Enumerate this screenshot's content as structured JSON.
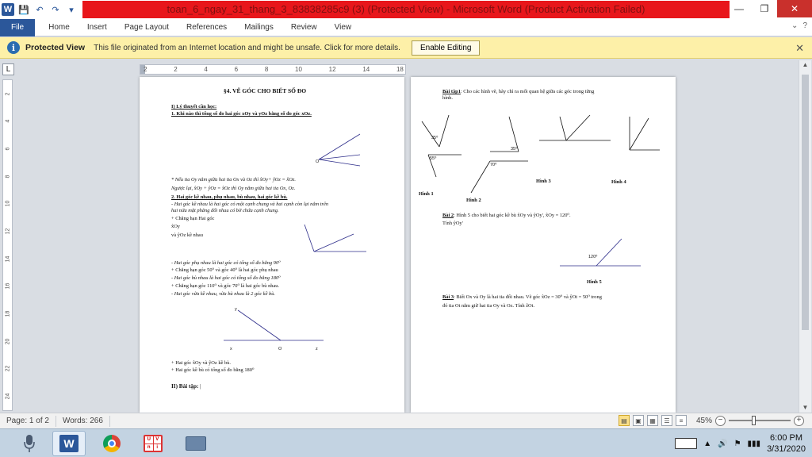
{
  "window": {
    "title": "toan_6_ngay_31_thang_3_83838285c9 (3) (Protected View) - Microsoft Word (Product Activation Failed)",
    "word_logo_letter": "W",
    "save_glyph": "💾",
    "undo_glyph": "↶",
    "redo_glyph": "↷",
    "qat_more_glyph": "▾",
    "minimize_glyph": "—",
    "restore_glyph": "❐",
    "close_glyph": "✕"
  },
  "ribbon": {
    "tabs": [
      "File",
      "Home",
      "Insert",
      "Page Layout",
      "References",
      "Mailings",
      "Review",
      "View"
    ],
    "help_glyph": "?",
    "expand_glyph": "⌄"
  },
  "protected_view": {
    "info_glyph": "i",
    "title": "Protected View",
    "message": "This file originated from an Internet location and might be unsafe. Click for more details.",
    "button": "Enable Editing",
    "close_glyph": "✕"
  },
  "ruler": {
    "corner_glyph": "L",
    "h_ticks": [
      "2",
      "2",
      "4",
      "6",
      "8",
      "10",
      "12",
      "14",
      "18"
    ],
    "v_ticks": [
      "2",
      "4",
      "6",
      "8",
      "10",
      "12",
      "14",
      "16",
      "18",
      "20",
      "22",
      "24"
    ]
  },
  "page1": {
    "title": "§4. VẼ GÓC CHO BIẾT SỐ ĐO",
    "section1": "I) Lý thuyết cần  học:",
    "q1": "1. Khi nào thì tổng số đo hai góc xOy và yOz bằng số đo góc xOz.",
    "note1": "* Nếu tia Oy nằm giữa hai tia Ox và Oz thì x̂Oy+ ŷOz = x̂Oz.",
    "note2": " Ngược lại, x̂Oy + ŷOz = x̂Oz thì Oy nằm giữa hai tia Ox, Oz.",
    "q2": "2.  Hai góc kề nhau, phụ nhau, bù nhau, hai góc kề bù.",
    "def1": "-  Hai góc kề nhau là hai góc có một cạnh chung và hai cạnh còn lại nằm trên",
    "def1b": "hai nửa mặt phẳng đối nhau có bờ chứa cạnh chung.",
    "ex1a": "+    Chẳng   hạn   Hai    góc",
    "ex1b": "x̂Oy",
    "ex1c": " và  ŷOz  kề nhau",
    "def2": "-  Hai góc phụ nhau là hai góc có tổng số đo bằng 90⁰",
    "ex2": "+ Chẳng hạn góc 50⁰  và góc 40⁰ là hai góc phụ nhau",
    "def3": "- Hai góc bù nhau là hai góc có tổng số đo bằng 180⁰",
    "ex3": "+ Chẳng hạn góc 110⁰  và góc 70⁰ là hai góc bù nhau.",
    "def4": "- Hai góc vừa kề nhau, vừa bù nhau là 2 góc kề bù.",
    "fig_x": "x",
    "fig_o": "O",
    "fig_z": "z",
    "fig_y": "y",
    "res1": "+ Hai góc  x̂Oy và  ŷOz kề bù.",
    "res2": "+ Hai góc kề bù có tổng số đo bằng 180⁰",
    "section2": "II) Bài tập:"
  },
  "page2": {
    "ex1_label": "Bài tập1",
    "ex1_text": ": Cho các hình vẽ, hãy chỉ ra mối quan hệ giữa các góc trong từng",
    "ex1_text2": "hình.",
    "angle_a": "35⁰",
    "angle_b": "55⁰",
    "angle_c": "35⁰",
    "angle_d": "70⁰",
    "fig1": "Hình 1",
    "fig2": "Hình 2",
    "fig3": "Hình 3",
    "fig4": "Hình 4",
    "ex2_label": "Bài 2",
    "ex2_text": ":  Hình 5 cho biết hai góc kề bù  x̂Oy và  ŷOy', x̂Oy = 120⁰.",
    "ex2_text2": "Tính ŷOy'",
    "fig5_angle": "120⁰",
    "fig5": "Hình 5",
    "ex3_label": "Bài 3",
    "ex3_text": ": Biết Ox và Oy là hai tia đối nhau. Vẽ góc  x̂Oz = 30⁰ và ŷOt = 50⁰ trong",
    "ex3_text2": "đó tia Ot nằm giữ hai tia Oy và Oz. Tính ẑOt."
  },
  "status": {
    "page": "Page: 1 of 2",
    "words": "Words: 266",
    "zoom": "45%",
    "zoom_minus": "−",
    "zoom_plus": "+",
    "view_glyphs": [
      "▤",
      "▣",
      "▦",
      "☰",
      "≡"
    ]
  },
  "taskbar": {
    "word_letter": "W",
    "unikey_letters": [
      "U",
      "V",
      "n",
      "i"
    ],
    "time": "6:00 PM",
    "date": "3/31/2020",
    "tray_glyphs": [
      "▲",
      "🔊",
      "⚑",
      "▮▮▮"
    ]
  },
  "colors": {
    "word_blue": "#2b579a",
    "title_red": "#e8161b",
    "protected_yellow": "#fdf0a8"
  }
}
